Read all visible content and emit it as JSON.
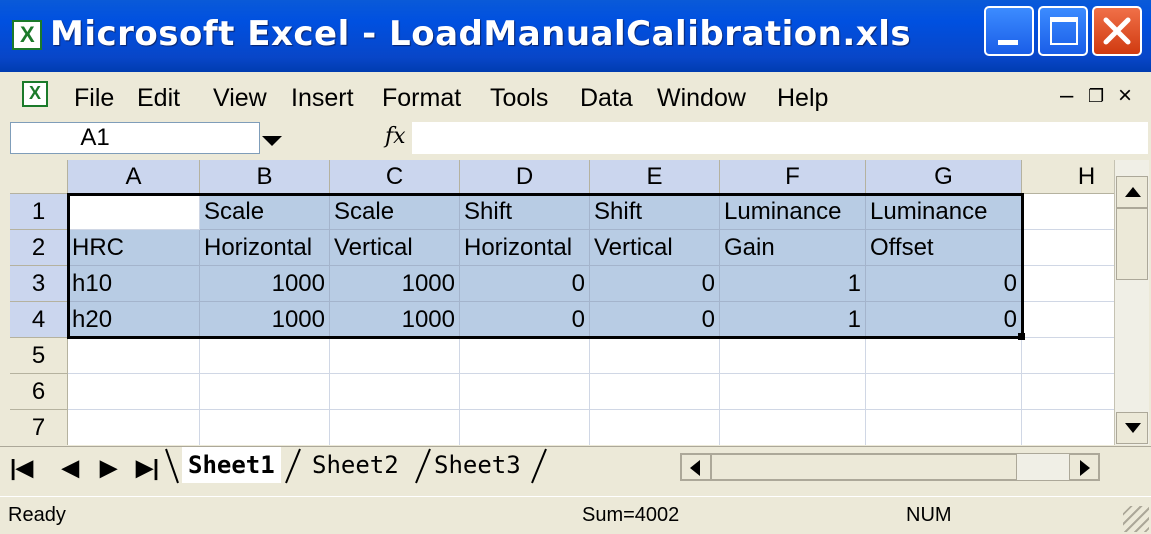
{
  "window": {
    "title": "Microsoft Excel - LoadManualCalibration.xls"
  },
  "menu": [
    "File",
    "Edit",
    "View",
    "Insert",
    "Format",
    "Tools",
    "Data",
    "Window",
    "Help"
  ],
  "formula_bar": {
    "name_box": "A1",
    "fx_label": "fx",
    "content": ""
  },
  "columns": [
    "A",
    "B",
    "C",
    "D",
    "E",
    "F",
    "G",
    "H"
  ],
  "rows": [
    "1",
    "2",
    "3",
    "4",
    "5",
    "6",
    "7"
  ],
  "cells": {
    "r1": [
      "",
      "Scale",
      "Scale",
      "Shift",
      "Shift",
      "Luminance",
      "Luminance"
    ],
    "r2": [
      "HRC",
      "Horizontal",
      "Vertical",
      "Horizontal",
      "Vertical",
      "Gain",
      "Offset"
    ],
    "r3": [
      "h10",
      "1000",
      "1000",
      "0",
      "0",
      "1",
      "0"
    ],
    "r4": [
      "h20",
      "1000",
      "1000",
      "0",
      "0",
      "1",
      "0"
    ]
  },
  "sheet_tabs": [
    "Sheet1",
    "Sheet2",
    "Sheet3"
  ],
  "active_sheet": "Sheet1",
  "status": {
    "ready": "Ready",
    "sum": "Sum=4002",
    "num": "NUM"
  },
  "colors": {
    "title_bar": "#0a5ad8",
    "selection": "#b8cce4",
    "header_selected": "#cbd6ee"
  }
}
